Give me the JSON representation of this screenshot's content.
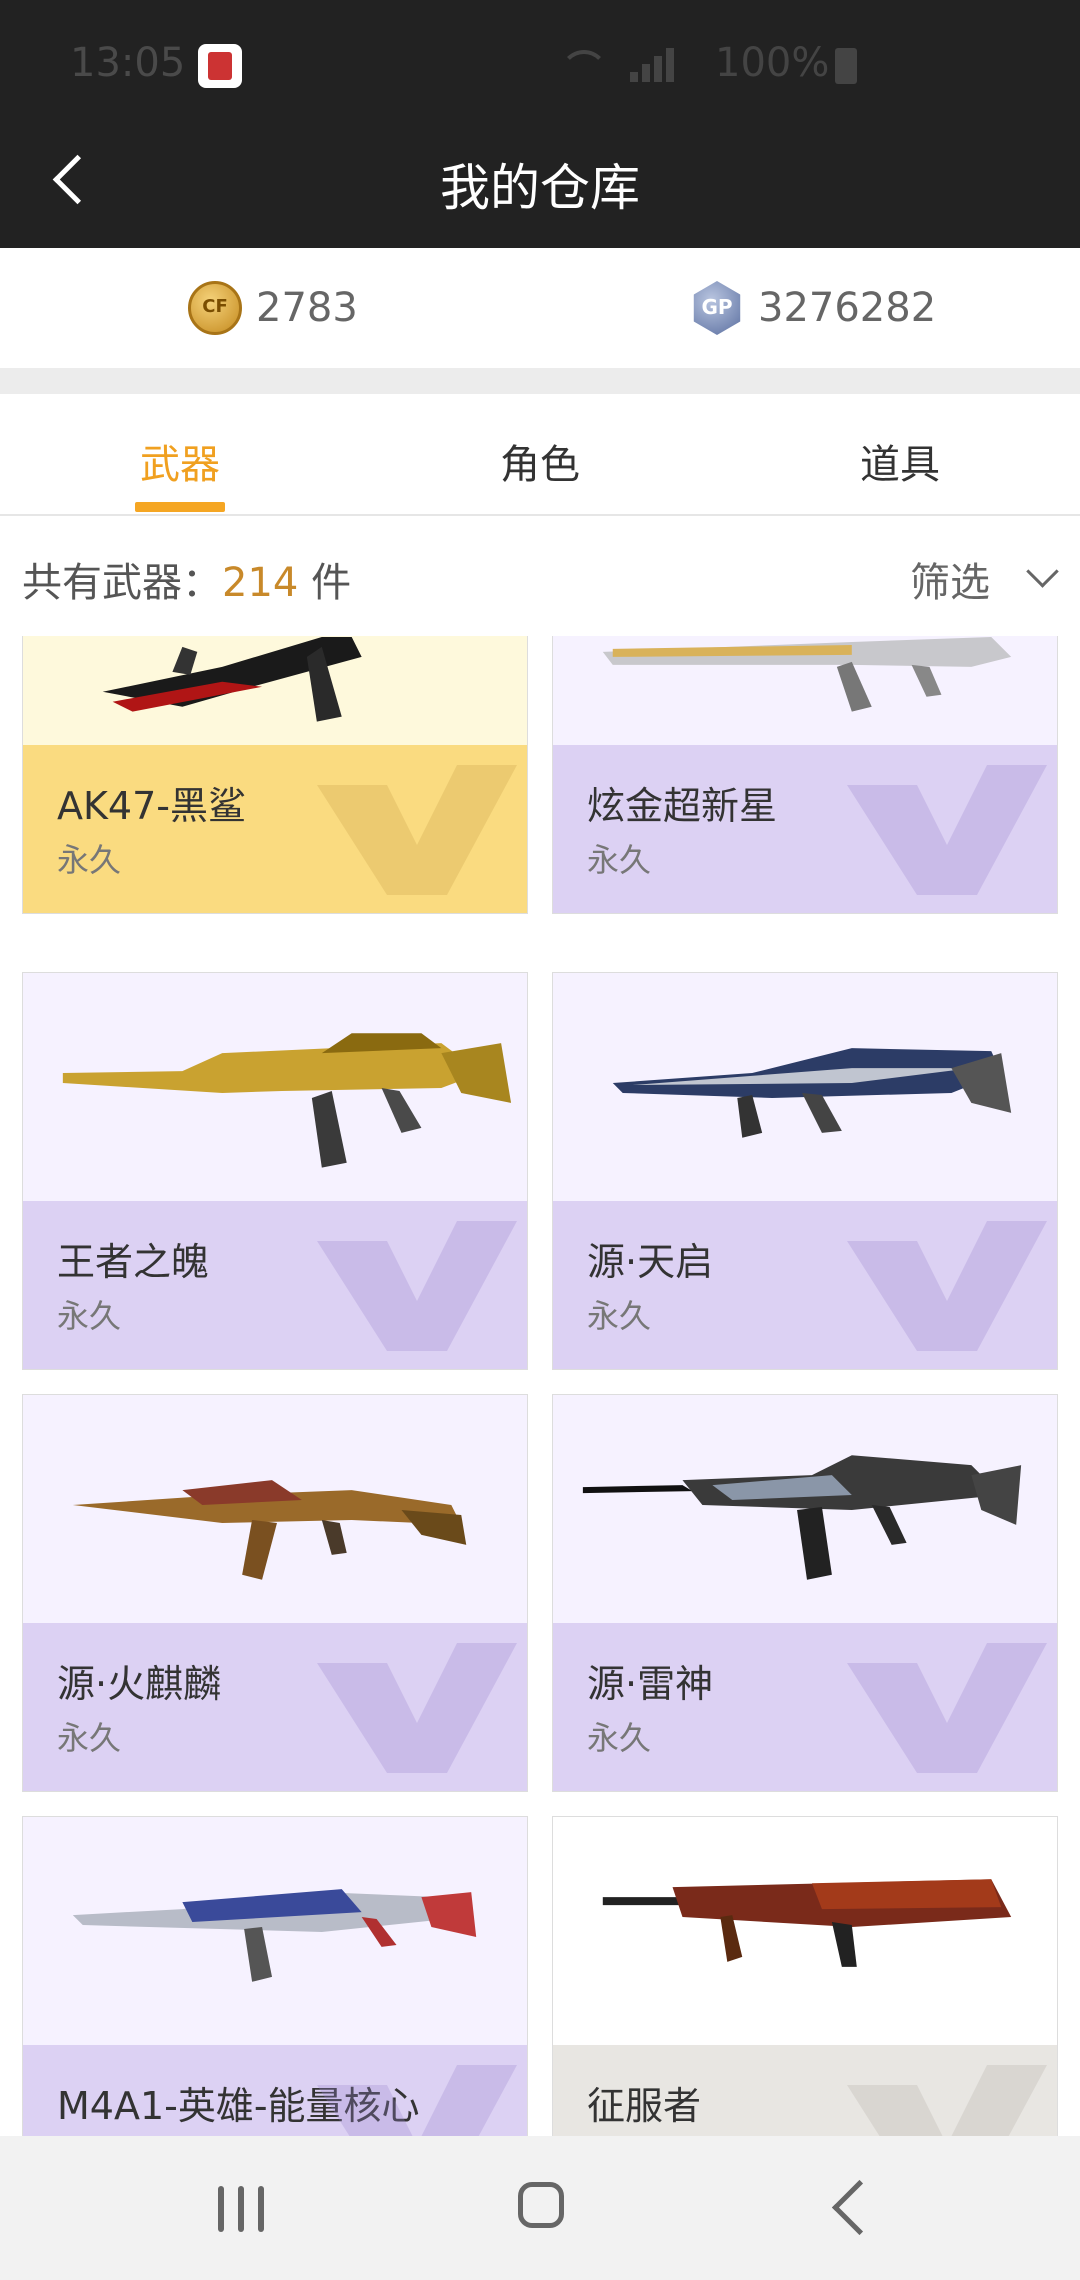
{
  "status_bar": {
    "time": "13:05",
    "battery": "100%"
  },
  "header": {
    "title": "我的仓库"
  },
  "currency": {
    "cf_points": "2783",
    "gp_points": "3276282"
  },
  "tabs": [
    {
      "label": "武器",
      "active": true
    },
    {
      "label": "角色"
    },
    {
      "label": "道具"
    }
  ],
  "summary": {
    "label": "共有武器：",
    "count": "214",
    "unit": "件",
    "filter_label": "筛选"
  },
  "items": [
    {
      "name": "AK47-黑鲨",
      "duration": "永久",
      "style": "gold"
    },
    {
      "name": "炫金超新星",
      "duration": "永久",
      "style": "purple"
    },
    {
      "name": "王者之魄",
      "duration": "永久",
      "style": "purple"
    },
    {
      "name": "源·天启",
      "duration": "永久",
      "style": "purple"
    },
    {
      "name": "源·火麒麟",
      "duration": "永久",
      "style": "purple"
    },
    {
      "name": "源·雷神",
      "duration": "永久",
      "style": "purple"
    },
    {
      "name": "M4A1-英雄-能量核心",
      "duration": "",
      "style": "purple"
    },
    {
      "name": "征服者",
      "duration": "",
      "style": "gray"
    }
  ],
  "colors": {
    "accent": "#f5a623",
    "header_bg": "#222222",
    "gold_card": "#fadb80",
    "purple_card": "#dcd1f3"
  }
}
